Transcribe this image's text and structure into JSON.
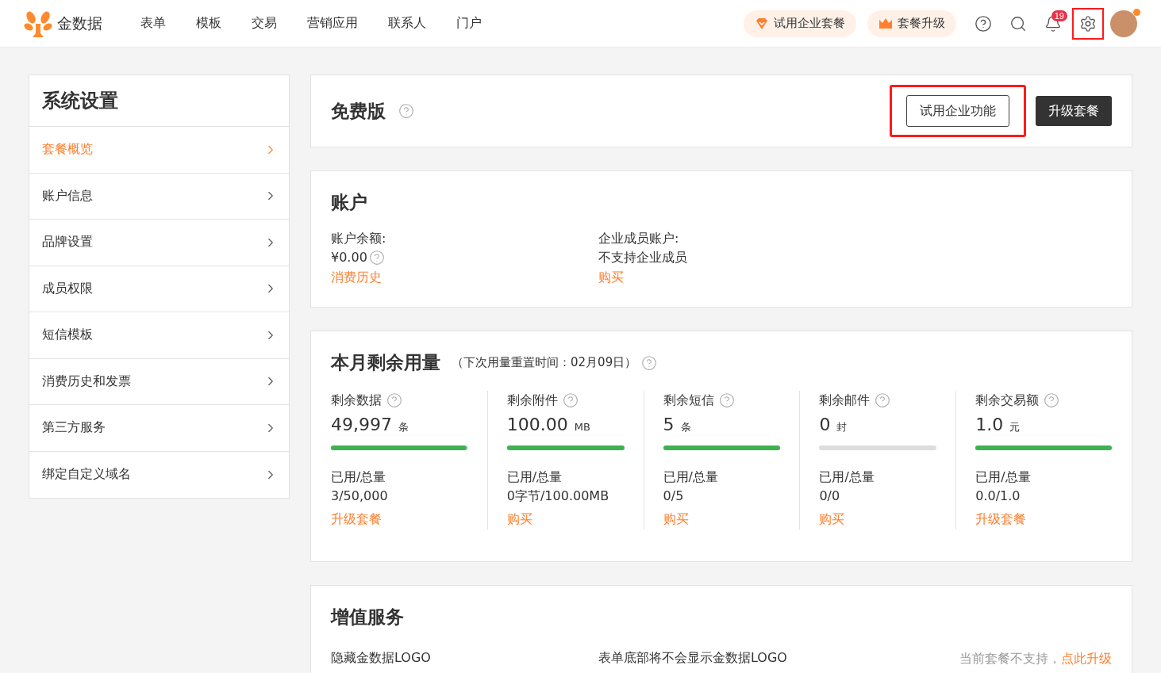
{
  "header": {
    "brand": "金数据",
    "nav": [
      {
        "label": "表单",
        "selected": false
      },
      {
        "label": "模板",
        "selected": false
      },
      {
        "label": "交易",
        "selected": false
      },
      {
        "label": "营销应用",
        "selected": false
      },
      {
        "label": "联系人",
        "selected": false
      },
      {
        "label": "门户",
        "selected": false
      }
    ],
    "trial_pill": "试用企业套餐",
    "upgrade_pill": "套餐升级",
    "notification_count": "19",
    "settings_highlighted": true,
    "avatar_dot": true
  },
  "sidebar": {
    "title": "系统设置",
    "items": [
      {
        "label": "套餐概览",
        "selected": true
      },
      {
        "label": "账户信息",
        "selected": false
      },
      {
        "label": "品牌设置",
        "selected": false
      },
      {
        "label": "成员权限",
        "selected": false
      },
      {
        "label": "短信模板",
        "selected": false
      },
      {
        "label": "消费历史和发票",
        "selected": false
      },
      {
        "label": "第三方服务",
        "selected": false
      },
      {
        "label": "绑定自定义域名",
        "selected": false
      }
    ]
  },
  "plan": {
    "title": "免费版",
    "trial_button": "试用企业功能",
    "trial_highlighted": true,
    "upgrade_button": "升级套餐"
  },
  "account": {
    "title": "账户",
    "columns": [
      {
        "label": "账户余额:",
        "value": "¥0.00",
        "help": true,
        "link": "消费历史"
      },
      {
        "label": "企业成员账户:",
        "value": "不支持企业成员",
        "help": false,
        "link": "购买"
      }
    ]
  },
  "usage": {
    "title": "本月剩余用量",
    "subtitle": "（下次用量重置时间：02月09日）",
    "items": [
      {
        "label": "剩余数据",
        "amount": "49,997",
        "unit": "条",
        "level": 0.99,
        "used_label": "已用/总量",
        "used": "3/50,000",
        "link": "升级套餐"
      },
      {
        "label": "剩余附件",
        "amount": "100.00",
        "unit": "MB",
        "level": 1,
        "used_label": "已用/总量",
        "used": "0字节/100.00MB",
        "link": "购买"
      },
      {
        "label": "剩余短信",
        "amount": "5",
        "unit": "条",
        "level": 1,
        "used_label": "已用/总量",
        "used": "0/5",
        "link": "购买"
      },
      {
        "label": "剩余邮件",
        "amount": "0",
        "unit": "封",
        "level": 0,
        "used_label": "已用/总量",
        "used": "0/0",
        "link": "购买"
      },
      {
        "label": "剩余交易额",
        "amount": "1.0",
        "unit": "元",
        "level": 1,
        "used_label": "已用/总量",
        "used": "0.0/1.0",
        "link": "升级套餐"
      }
    ]
  },
  "value_added": {
    "title": "增值服务",
    "rows": [
      {
        "name": "隐藏金数据LOGO",
        "description": "表单底部将不会显示金数据LOGO",
        "status": "当前套餐不支持，",
        "link": "点此升级"
      }
    ]
  }
}
